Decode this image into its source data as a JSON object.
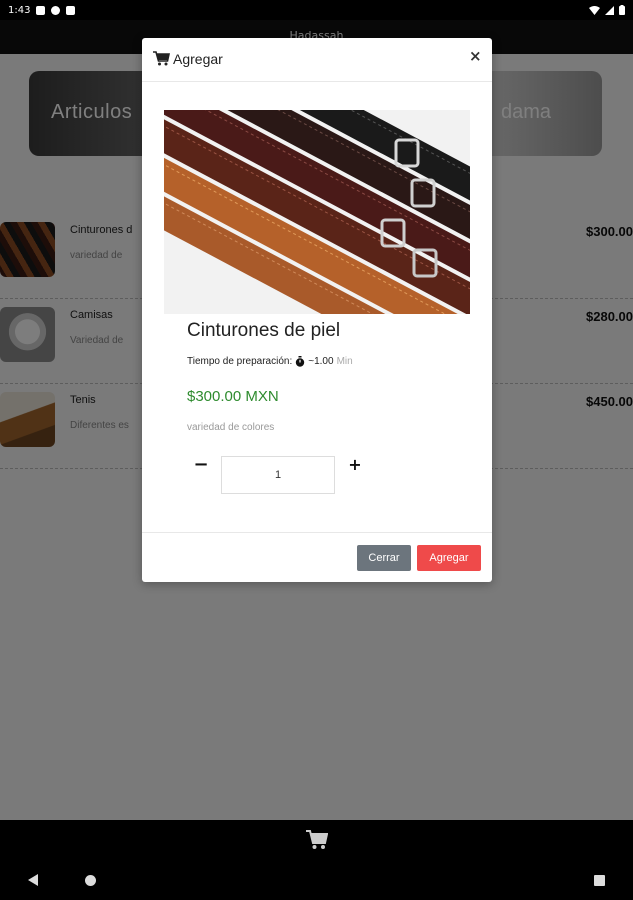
{
  "status_bar": {
    "time": "1:43"
  },
  "app": {
    "title": "Hadassah"
  },
  "banner": {
    "text_left": "Articulos",
    "text_right": "dama"
  },
  "products": [
    {
      "name": "Cinturones d",
      "description": "variedad de",
      "price": "$300.00"
    },
    {
      "name": "Camisas",
      "description": "Variedad de",
      "price": "$280.00"
    },
    {
      "name": "Tenis",
      "description": "Diferentes es",
      "price": "$450.00"
    }
  ],
  "modal": {
    "title": "Agregar",
    "close_symbol": "×",
    "product_name": "Cinturones de piel",
    "prep_label": "Tiempo de preparación:",
    "prep_value": "~1.00",
    "prep_unit": "Min",
    "price": "$300.00 MXN",
    "description": "variedad de colores",
    "quantity": "1",
    "minus_symbol": "−",
    "plus_symbol": "+",
    "close_button": "Cerrar",
    "add_button": "Agregar"
  },
  "colors": {
    "price_green": "#2e8b2e",
    "add_button_red": "#ef4a4a",
    "close_button_gray": "#6c757d"
  },
  "icons": {
    "modal_header": "shopping-cart-icon",
    "timer": "stopwatch-icon",
    "bottom_bar": "shopping-cart-icon"
  }
}
